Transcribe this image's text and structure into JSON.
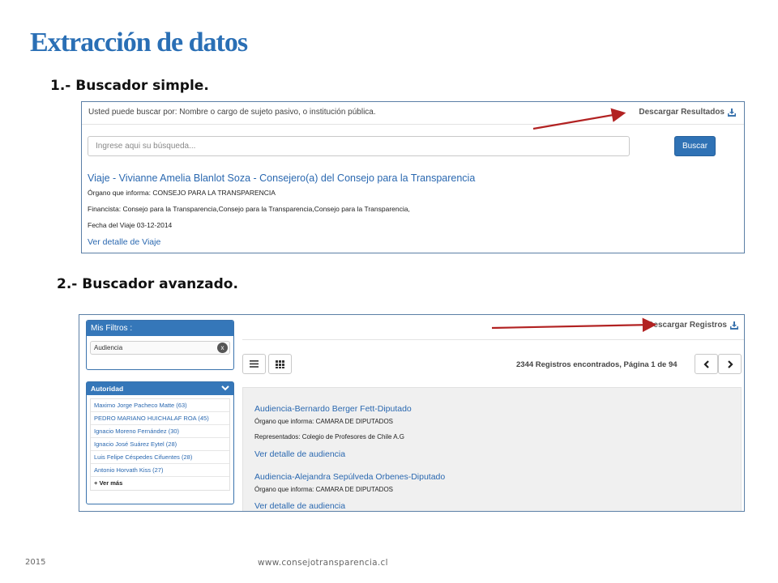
{
  "slide": {
    "title": "Extracción de datos",
    "section1": "1.- Buscador simple.",
    "section2": "2.- Buscador avanzado."
  },
  "simple_search": {
    "hint": "Usted puede buscar por: Nombre o cargo de sujeto pasivo, o institución pública.",
    "download_label": "Descargar Resultados",
    "download_icon": "download-icon",
    "placeholder": "Ingrese aqui su búsqueda...",
    "search_button": "Buscar",
    "result": {
      "title": "Viaje - Vivianne Amelia Blanlot Soza - Consejero(a) del Consejo para la Transparencia",
      "organo": "Órgano que informa: CONSEJO PARA LA TRANSPARENCIA",
      "financista": "Financista: Consejo para la Transparencia,Consejo para la Transparencia,Consejo para la Transparencia,",
      "fecha": "Fecha del Viaje 03-12-2014",
      "detail_link": "Ver detalle de Viaje"
    }
  },
  "advanced_search": {
    "filters_title": "Mis Filtros :",
    "active_filter": "Audiencia",
    "autoridad_title": "Autoridad",
    "autoridad_items": [
      "Maximo Jorge Pacheco Matte (63)",
      "PEDRO MARIANO HUICHALAF ROA (45)",
      "Ignacio Moreno Fernández (30)",
      "Ignacio José Suárez Eytel (28)",
      "Luis Felipe Céspedes Cifuentes (28)",
      "Antonio Horvath Kiss (27)"
    ],
    "ver_mas": "+ Ver más",
    "download_label": "Descargar Registros",
    "records_text": "2344 Registros encontrados, Página 1 de 94",
    "results": [
      {
        "title": "Audiencia-Bernardo Berger Fett-Diputado",
        "organo": "Órgano que informa: CAMARA DE DIPUTADOS",
        "representados": "Representados: Colegio de Profesores de Chile A.G",
        "detail_link": "Ver detalle de audiencia"
      },
      {
        "title": "Audiencia-Alejandra Sepúlveda Orbenes-Diputado",
        "organo": "Órgano que informa: CAMARA DE DIPUTADOS",
        "detail_link": "Ver detalle de audiencia"
      }
    ]
  },
  "footer": {
    "year": "2015",
    "url": "www.consejotransparencia.cl"
  },
  "colors": {
    "title_blue": "#2a6fb5",
    "link_blue": "#2a68b0",
    "button_blue": "#2f72b5",
    "arrow_red": "#b22222"
  }
}
